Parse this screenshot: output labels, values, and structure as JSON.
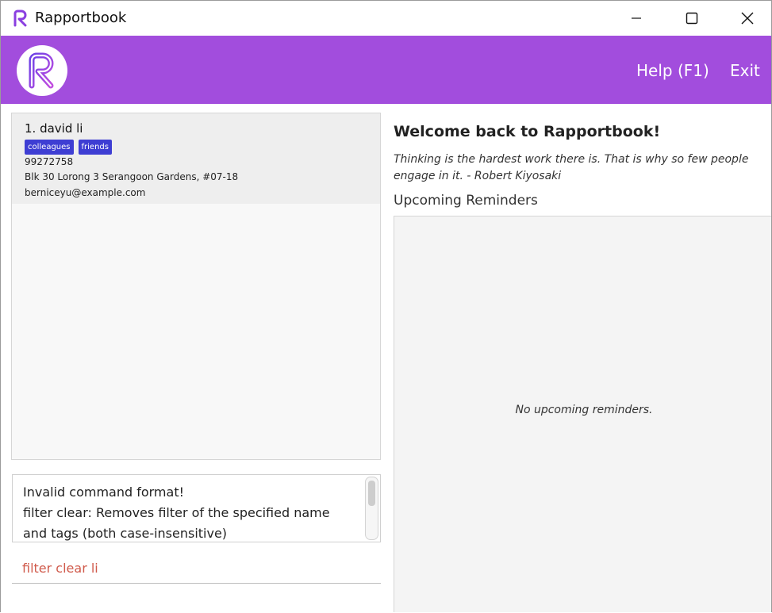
{
  "window": {
    "title": "Rapportbook"
  },
  "header": {
    "menu": {
      "help_label": "Help (F1)",
      "exit_label": "Exit"
    },
    "accent_color": "#a24ddd"
  },
  "person_list": {
    "persons": [
      {
        "index_name": "1.  david li",
        "tags": [
          "colleagues",
          "friends"
        ],
        "phone": "99272758",
        "address": "Blk 30 Lorong 3 Serangoon Gardens, #07-18",
        "email": "berniceyu@example.com"
      }
    ],
    "tag_color": "#3e3ed3"
  },
  "result_display": {
    "lines": [
      "Invalid command format!",
      "filter clear: Removes filter of the specified name and tags (both case-insensitive)"
    ]
  },
  "command_box": {
    "value": "filter clear li",
    "error_color": "#d05a4b"
  },
  "welcome_panel": {
    "heading": "Welcome back to Rapportbook!",
    "quote": "Thinking is the hardest work there is. That is why so few people engage in it. - Robert Kiyosaki",
    "reminders_label": "Upcoming Reminders",
    "empty_reminders": "No upcoming reminders."
  }
}
